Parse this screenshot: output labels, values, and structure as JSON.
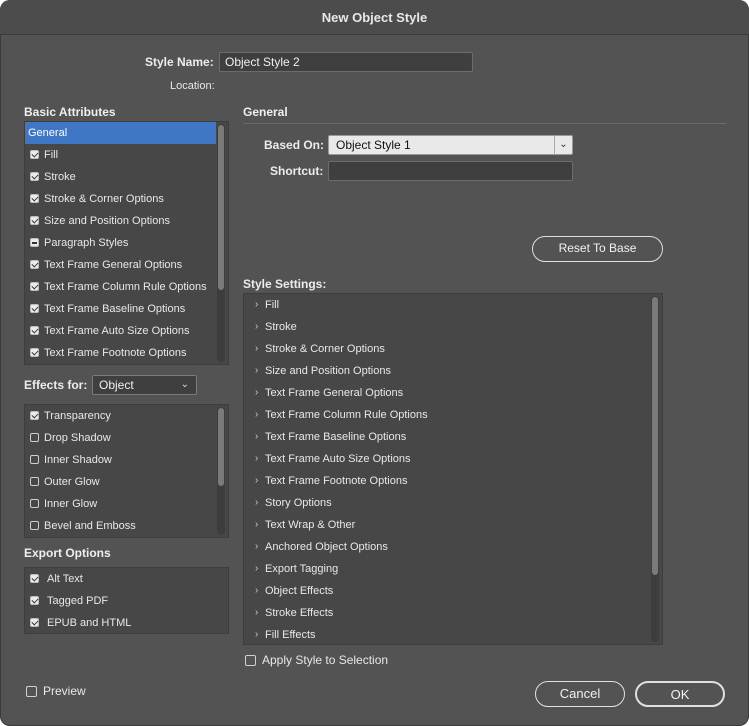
{
  "window": {
    "title": "New Object Style"
  },
  "style_name": {
    "label": "Style Name:",
    "value": "Object Style 2"
  },
  "location": {
    "label": "Location:"
  },
  "basic_attributes": {
    "title": "Basic Attributes",
    "items": [
      {
        "label": "General",
        "state": "none",
        "selected": true
      },
      {
        "label": "Fill",
        "state": "on"
      },
      {
        "label": "Stroke",
        "state": "on"
      },
      {
        "label": "Stroke & Corner Options",
        "state": "on"
      },
      {
        "label": "Size and Position Options",
        "state": "on"
      },
      {
        "label": "Paragraph Styles",
        "state": "mixed"
      },
      {
        "label": "Text Frame General Options",
        "state": "on"
      },
      {
        "label": "Text Frame Column Rule Options",
        "state": "on"
      },
      {
        "label": "Text Frame Baseline Options",
        "state": "on"
      },
      {
        "label": "Text Frame Auto Size Options",
        "state": "on"
      },
      {
        "label": "Text Frame Footnote Options",
        "state": "on"
      }
    ]
  },
  "effects_for": {
    "label": "Effects for:",
    "value": "Object",
    "items": [
      {
        "label": "Transparency",
        "state": "on"
      },
      {
        "label": "Drop Shadow",
        "state": "off"
      },
      {
        "label": "Inner Shadow",
        "state": "off"
      },
      {
        "label": "Outer Glow",
        "state": "off"
      },
      {
        "label": "Inner Glow",
        "state": "off"
      },
      {
        "label": "Bevel and Emboss",
        "state": "off"
      }
    ]
  },
  "export_options": {
    "title": "Export Options",
    "items": [
      {
        "label": "Alt Text",
        "state": "on"
      },
      {
        "label": "Tagged PDF",
        "state": "on"
      },
      {
        "label": "EPUB and HTML",
        "state": "on"
      }
    ]
  },
  "general": {
    "title": "General",
    "based_on": {
      "label": "Based On:",
      "value": "Object Style 1"
    },
    "shortcut": {
      "label": "Shortcut:",
      "value": ""
    },
    "reset_button": "Reset To Base",
    "style_settings_label": "Style Settings:",
    "settings": [
      "Fill",
      "Stroke",
      "Stroke & Corner Options",
      "Size and Position Options",
      "Text Frame General Options",
      "Text Frame Column Rule Options",
      "Text Frame Baseline Options",
      "Text Frame Auto Size Options",
      "Text Frame Footnote Options",
      "Story Options",
      "Text Wrap & Other",
      "Anchored Object Options",
      "Export Tagging",
      "Object Effects",
      "Stroke Effects",
      "Fill Effects"
    ],
    "apply_to_selection": {
      "label": "Apply Style to Selection",
      "checked": false
    }
  },
  "footer": {
    "preview": {
      "label": "Preview",
      "checked": false
    },
    "cancel": "Cancel",
    "ok": "OK"
  }
}
